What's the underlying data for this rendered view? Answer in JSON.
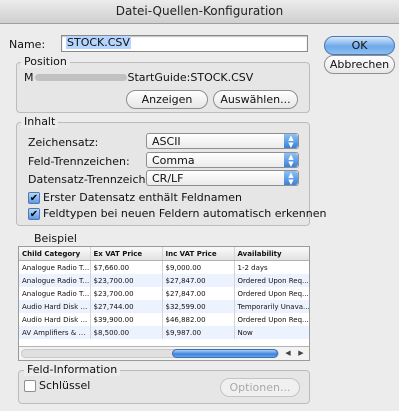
{
  "window": {
    "title": "Datei-Quellen-Konfiguration"
  },
  "name_field": {
    "label": "Name:",
    "value": "STOCK.CSV"
  },
  "buttons": {
    "ok": "OK",
    "cancel": "Abbrechen",
    "show": "Anzeigen",
    "choose": "Auswählen...",
    "options": "Optionen..."
  },
  "position": {
    "legend": "Position",
    "path_prefix": "M",
    "path_suffix": "StartGuide:STOCK.CSV"
  },
  "inhalt": {
    "legend": "Inhalt",
    "charset_label": "Zeichensatz:",
    "charset_value": "ASCII",
    "field_sep_label": "Feld-Trennzeichen:",
    "field_sep_value": "Comma",
    "record_sep_label": "Datensatz-Trennzeichen:",
    "record_sep_value": "CR/LF",
    "check_first_record": "Erster Datensatz enthält Feldnamen",
    "check_first_record_checked": true,
    "check_detect_types": "Feldtypen bei neuen Feldern automatisch erkennen",
    "check_detect_types_checked": true
  },
  "beispiel": {
    "legend": "Beispiel",
    "columns": [
      "Child Category",
      "Ex VAT Price",
      "Inc VAT Price",
      "Availability"
    ],
    "rows": [
      [
        "Analogue Radio T...",
        "$7,660.00",
        "$9,000.00",
        "1-2 days"
      ],
      [
        "Analogue Radio T...",
        "$23,700.00",
        "$27,847.00",
        "Ordered Upon Req..."
      ],
      [
        "Analogue Radio T...",
        "$23,700.00",
        "$27,847.00",
        "Ordered Upon Req..."
      ],
      [
        "Audio Hard Disk R...",
        "$27,744.00",
        "$32,599.00",
        "Temporarily Unava..."
      ],
      [
        "Audio Hard Disk R...",
        "$39,900.00",
        "$46,882.00",
        "Ordered Upon Req..."
      ],
      [
        "AV Amplifiers & Rec...",
        "$8,500.00",
        "$9,987.00",
        "Now"
      ]
    ],
    "scroll_left_icon": "scroll-left-icon",
    "scroll_right_icon": "scroll-right-icon"
  },
  "feld_information": {
    "legend": "Feld-Information",
    "key_label": "Schlüssel",
    "key_checked": false
  },
  "colors": {
    "accent": "#3b83dc",
    "selection": "#b5d5ff"
  }
}
